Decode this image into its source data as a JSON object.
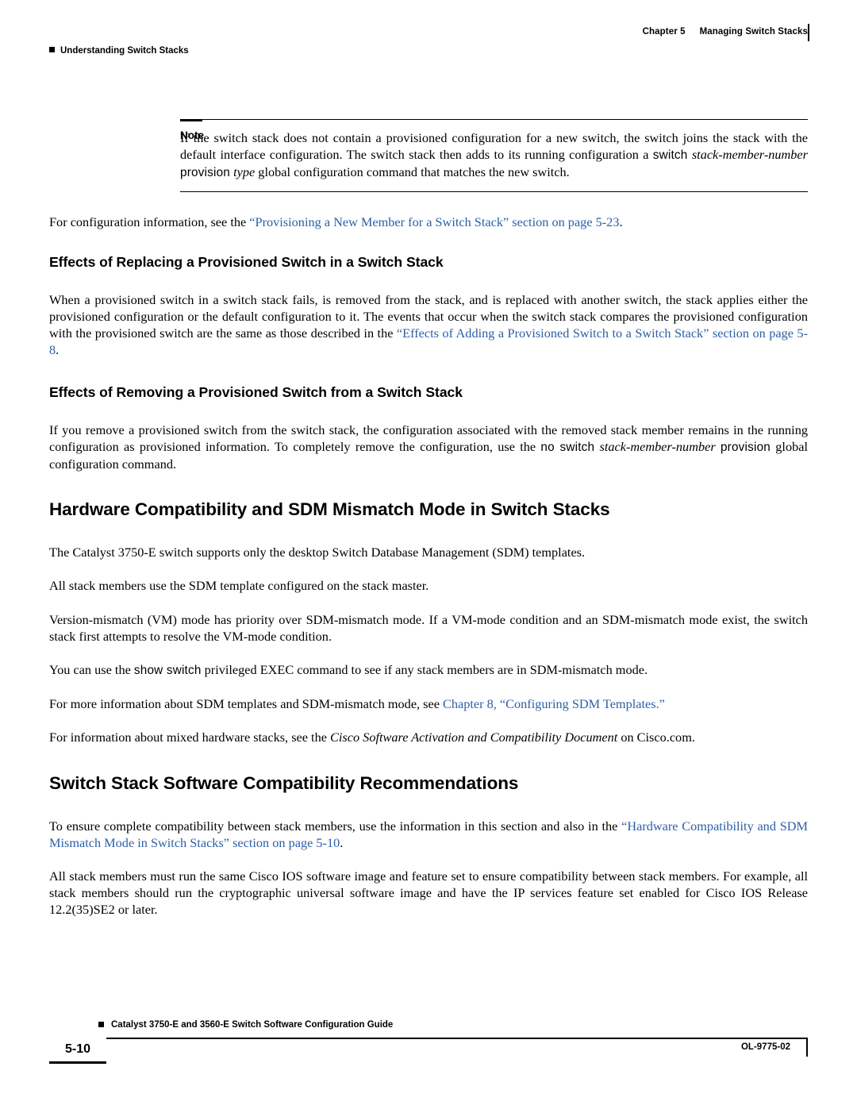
{
  "header": {
    "chapter": "Chapter 5",
    "chapter_title": "Managing Switch Stacks",
    "running_head": "Understanding Switch Stacks"
  },
  "note": {
    "label": "Note",
    "text_1": "If the switch stack does not contain a provisioned configuration for a new switch, the switch joins the stack with the default interface configuration. The switch stack then adds to its running configuration a ",
    "cmd_1": "switch",
    "ital_1": "stack-member-number",
    "cmd_2": "provision",
    "ital_2": "type",
    "text_2": " global configuration command that matches the new switch."
  },
  "paragraphs": {
    "p_config_info_pre": "For configuration information, see the ",
    "p_config_info_link": "“Provisioning a New Member for a Switch Stack” section on page 5-23",
    "p_config_info_post": ".",
    "p_replacing": "When a provisioned switch in a switch stack fails, is removed from the stack, and is replaced with another switch, the stack applies either the provisioned configuration or the default configuration to it. The events that occur when the switch stack compares the provisioned configuration with the provisioned switch are the same as those described in the ",
    "p_replacing_link": "“Effects of Adding a Provisioned Switch to a Switch Stack” section on page 5-8",
    "p_replacing_post": ".",
    "p_removing_1": "If you remove a provisioned switch from the switch stack, the configuration associated with the removed stack member remains in the running configuration as provisioned information. To completely remove the configuration, use the ",
    "p_removing_cmd1": "no switch",
    "p_removing_ital1": "stack-member-number",
    "p_removing_cmd2": "provision",
    "p_removing_2": " global configuration command.",
    "p_sdm_1": "The Catalyst 3750-E switch supports only the desktop Switch Database Management (SDM) templates.",
    "p_sdm_2": "All stack members use the SDM template configured on the stack master.",
    "p_sdm_3": "Version-mismatch (VM) mode has priority over SDM-mismatch mode. If a VM-mode condition and an SDM-mismatch mode exist, the switch stack first attempts to resolve the VM-mode condition.",
    "p_sdm_4_pre": "You can use the ",
    "p_sdm_4_cmd": "show switch",
    "p_sdm_4_post": " privileged EXEC command to see if any stack members are in SDM-mismatch mode.",
    "p_sdm_5_pre": "For more information about SDM templates and SDM-mismatch mode, see ",
    "p_sdm_5_link": "Chapter 8, “Configuring SDM Templates.”",
    "p_sdm_6_pre": "For information about mixed hardware stacks, see the ",
    "p_sdm_6_ital": "Cisco Software Activation and Compatibility Document",
    "p_sdm_6_post": " on Cisco.com.",
    "p_compat_1_pre": "To ensure complete compatibility between stack members, use the information in this section and also in the ",
    "p_compat_1_link": "“Hardware Compatibility and SDM Mismatch Mode in Switch Stacks” section on page 5-10",
    "p_compat_1_post": ".",
    "p_compat_2": "All stack members must run the same Cisco IOS software image and feature set to ensure compatibility between stack members. For example, all stack members should run the cryptographic universal software image and have the IP services feature set enabled for Cisco IOS Release 12.2(35)SE2 or later."
  },
  "headings": {
    "h3_replacing": "Effects of Replacing a Provisioned Switch in a Switch Stack",
    "h3_removing": "Effects of Removing a Provisioned Switch from a Switch Stack",
    "h2_hardware": "Hardware Compatibility and SDM Mismatch Mode in Switch Stacks",
    "h2_compat": "Switch Stack Software Compatibility Recommendations"
  },
  "footer": {
    "guide_title": "Catalyst 3750-E and 3560-E Switch Software Configuration Guide",
    "page_number": "5-10",
    "doc_id": "OL-9775-02"
  },
  "colors": {
    "link": "#2b5fa8",
    "text": "#000000",
    "background": "#ffffff"
  }
}
